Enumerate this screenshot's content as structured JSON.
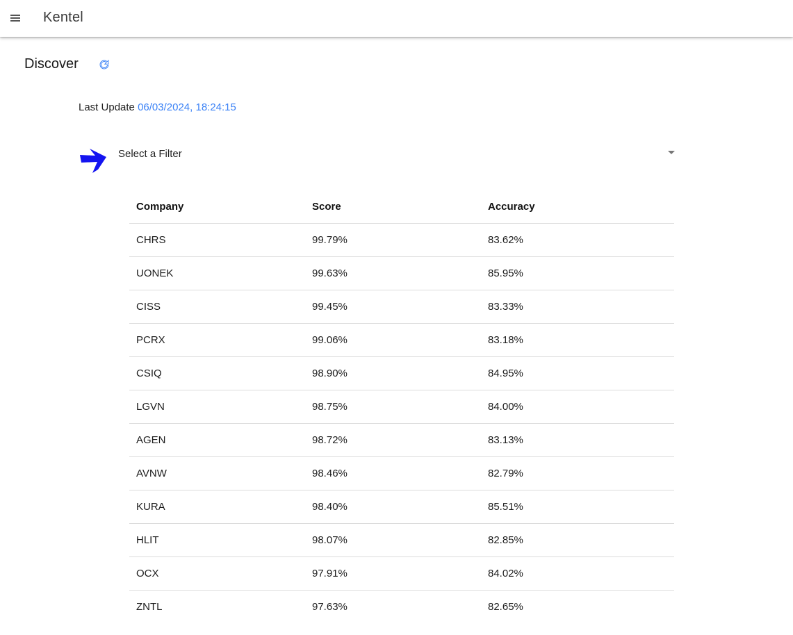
{
  "app": {
    "title": "Kentel"
  },
  "page": {
    "title": "Discover"
  },
  "last_update": {
    "label": "Last Update",
    "timestamp": "06/03/2024, 18:24:15"
  },
  "filter": {
    "placeholder": "Select a Filter"
  },
  "table": {
    "headers": [
      "Company",
      "Score",
      "Accuracy"
    ],
    "rows": [
      [
        "CHRS",
        "99.79%",
        "83.62%"
      ],
      [
        "UONEK",
        "99.63%",
        "85.95%"
      ],
      [
        "CISS",
        "99.45%",
        "83.33%"
      ],
      [
        "PCRX",
        "99.06%",
        "83.18%"
      ],
      [
        "CSIQ",
        "98.90%",
        "84.95%"
      ],
      [
        "LGVN",
        "98.75%",
        "84.00%"
      ],
      [
        "AGEN",
        "98.72%",
        "83.13%"
      ],
      [
        "AVNW",
        "98.46%",
        "82.79%"
      ],
      [
        "KURA",
        "98.40%",
        "85.51%"
      ],
      [
        "HLIT",
        "98.07%",
        "82.85%"
      ],
      [
        "OCX",
        "97.91%",
        "84.02%"
      ],
      [
        "ZNTL",
        "97.63%",
        "82.65%"
      ]
    ]
  },
  "colors": {
    "accent": "#3b82f6",
    "filter_icon": "#1414f0"
  },
  "icons": {
    "menu": "menu-icon",
    "refresh": "refresh-icon",
    "filter": "filter-arrow-icon",
    "dropdown": "chevron-down-icon"
  }
}
